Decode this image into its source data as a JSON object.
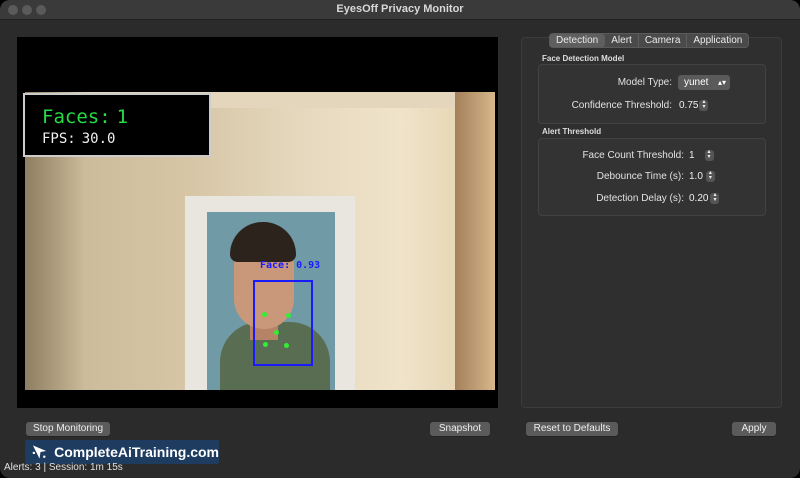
{
  "window": {
    "title": "EyesOff Privacy Monitor"
  },
  "video": {
    "overlay": {
      "faces_label": "Faces:",
      "faces_value": "1",
      "fps_label": "FPS:",
      "fps_value": "30.0"
    },
    "detection": {
      "label": "Face: 0.93"
    },
    "colors": {
      "box": "#1a1aff",
      "landmark": "#33ee33",
      "faces_text": "#22dd44"
    }
  },
  "tabs": [
    {
      "label": "Detection",
      "active": true
    },
    {
      "label": "Alert",
      "active": false
    },
    {
      "label": "Camera",
      "active": false
    },
    {
      "label": "Application",
      "active": false
    }
  ],
  "face_model": {
    "title": "Face Detection Model",
    "model_type_label": "Model Type:",
    "model_type_value": "yunet",
    "confidence_label": "Confidence Threshold:",
    "confidence_value": "0.75"
  },
  "alert_threshold": {
    "title": "Alert Threshold",
    "face_count_label": "Face Count Threshold:",
    "face_count_value": "1",
    "debounce_label": "Debounce Time (s):",
    "debounce_value": "1.0",
    "delay_label": "Detection Delay (s):",
    "delay_value": "0.20"
  },
  "buttons": {
    "stop": "Stop Monitoring",
    "snapshot": "Snapshot",
    "reset": "Reset to Defaults",
    "apply": "Apply"
  },
  "watermark": {
    "text": "CompleteAiTraining.com"
  },
  "status": {
    "text": "Alerts: 3 | Session: 1m 15s"
  },
  "icons": {
    "spin": "up-down-arrows-icon",
    "select": "chevron-up-down-icon",
    "logo": "brand-logo-icon"
  }
}
